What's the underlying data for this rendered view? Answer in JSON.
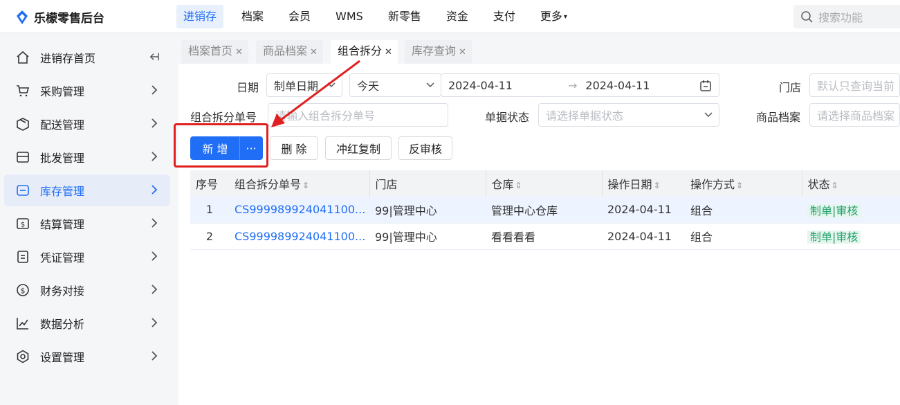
{
  "brand": {
    "name": "乐檬零售后台"
  },
  "top_nav": [
    {
      "label": "进销存",
      "active": true
    },
    {
      "label": "档案"
    },
    {
      "label": "会员"
    },
    {
      "label": "WMS"
    },
    {
      "label": "新零售"
    },
    {
      "label": "资金"
    },
    {
      "label": "支付"
    },
    {
      "label": "更多"
    }
  ],
  "top_search": {
    "placeholder": "搜索功能"
  },
  "sidebar": {
    "items": [
      {
        "label": "进销存首页",
        "icon": "home-icon"
      },
      {
        "label": "采购管理",
        "icon": "cart-icon"
      },
      {
        "label": "配送管理",
        "icon": "box-icon"
      },
      {
        "label": "批发管理",
        "icon": "wallet-icon"
      },
      {
        "label": "库存管理",
        "icon": "inventory-icon",
        "active": true
      },
      {
        "label": "结算管理",
        "icon": "settlement-icon"
      },
      {
        "label": "凭证管理",
        "icon": "voucher-icon"
      },
      {
        "label": "财务对接",
        "icon": "finance-icon"
      },
      {
        "label": "数据分析",
        "icon": "chart-icon"
      },
      {
        "label": "设置管理",
        "icon": "settings-icon"
      }
    ]
  },
  "tabs": [
    {
      "label": "档案首页"
    },
    {
      "label": "商品档案"
    },
    {
      "label": "组合拆分",
      "active": true
    },
    {
      "label": "库存查询"
    }
  ],
  "filters": {
    "date_label": "日期",
    "date_type": "制单日期",
    "date_range_preset": "今天",
    "date_start": "2024-04-11",
    "date_end": "2024-04-11",
    "store_label": "门店",
    "store_placeholder": "默认只查询当前",
    "order_no_label": "组合拆分单号",
    "order_no_placeholder": "请输入组合拆分单号",
    "status_label": "单据状态",
    "status_placeholder": "请选择单据状态",
    "product_label": "商品档案",
    "product_placeholder": "请选择商品档案"
  },
  "toolbar": {
    "add_label": "新 增",
    "more_label": "···",
    "delete_label": "删 除",
    "reverse_copy_label": "冲红复制",
    "unaudit_label": "反审核"
  },
  "table": {
    "headers": [
      "序号",
      "组合拆分单号",
      "门店",
      "仓库",
      "操作日期",
      "操作方式",
      "状态"
    ],
    "rows": [
      {
        "no": "1",
        "order": "CS999989924041100...",
        "store": "99|管理中心",
        "warehouse": "管理中心仓库",
        "date": "2024-04-11",
        "method": "组合",
        "status": "制单|审核"
      },
      {
        "no": "2",
        "order": "CS999989924041100...",
        "store": "99|管理中心",
        "warehouse": "看看看看",
        "date": "2024-04-11",
        "method": "组合",
        "status": "制单|审核"
      }
    ]
  },
  "colors": {
    "accent": "#1f6ef5",
    "annotation": "#e02020",
    "status_green": "#22a06b"
  }
}
